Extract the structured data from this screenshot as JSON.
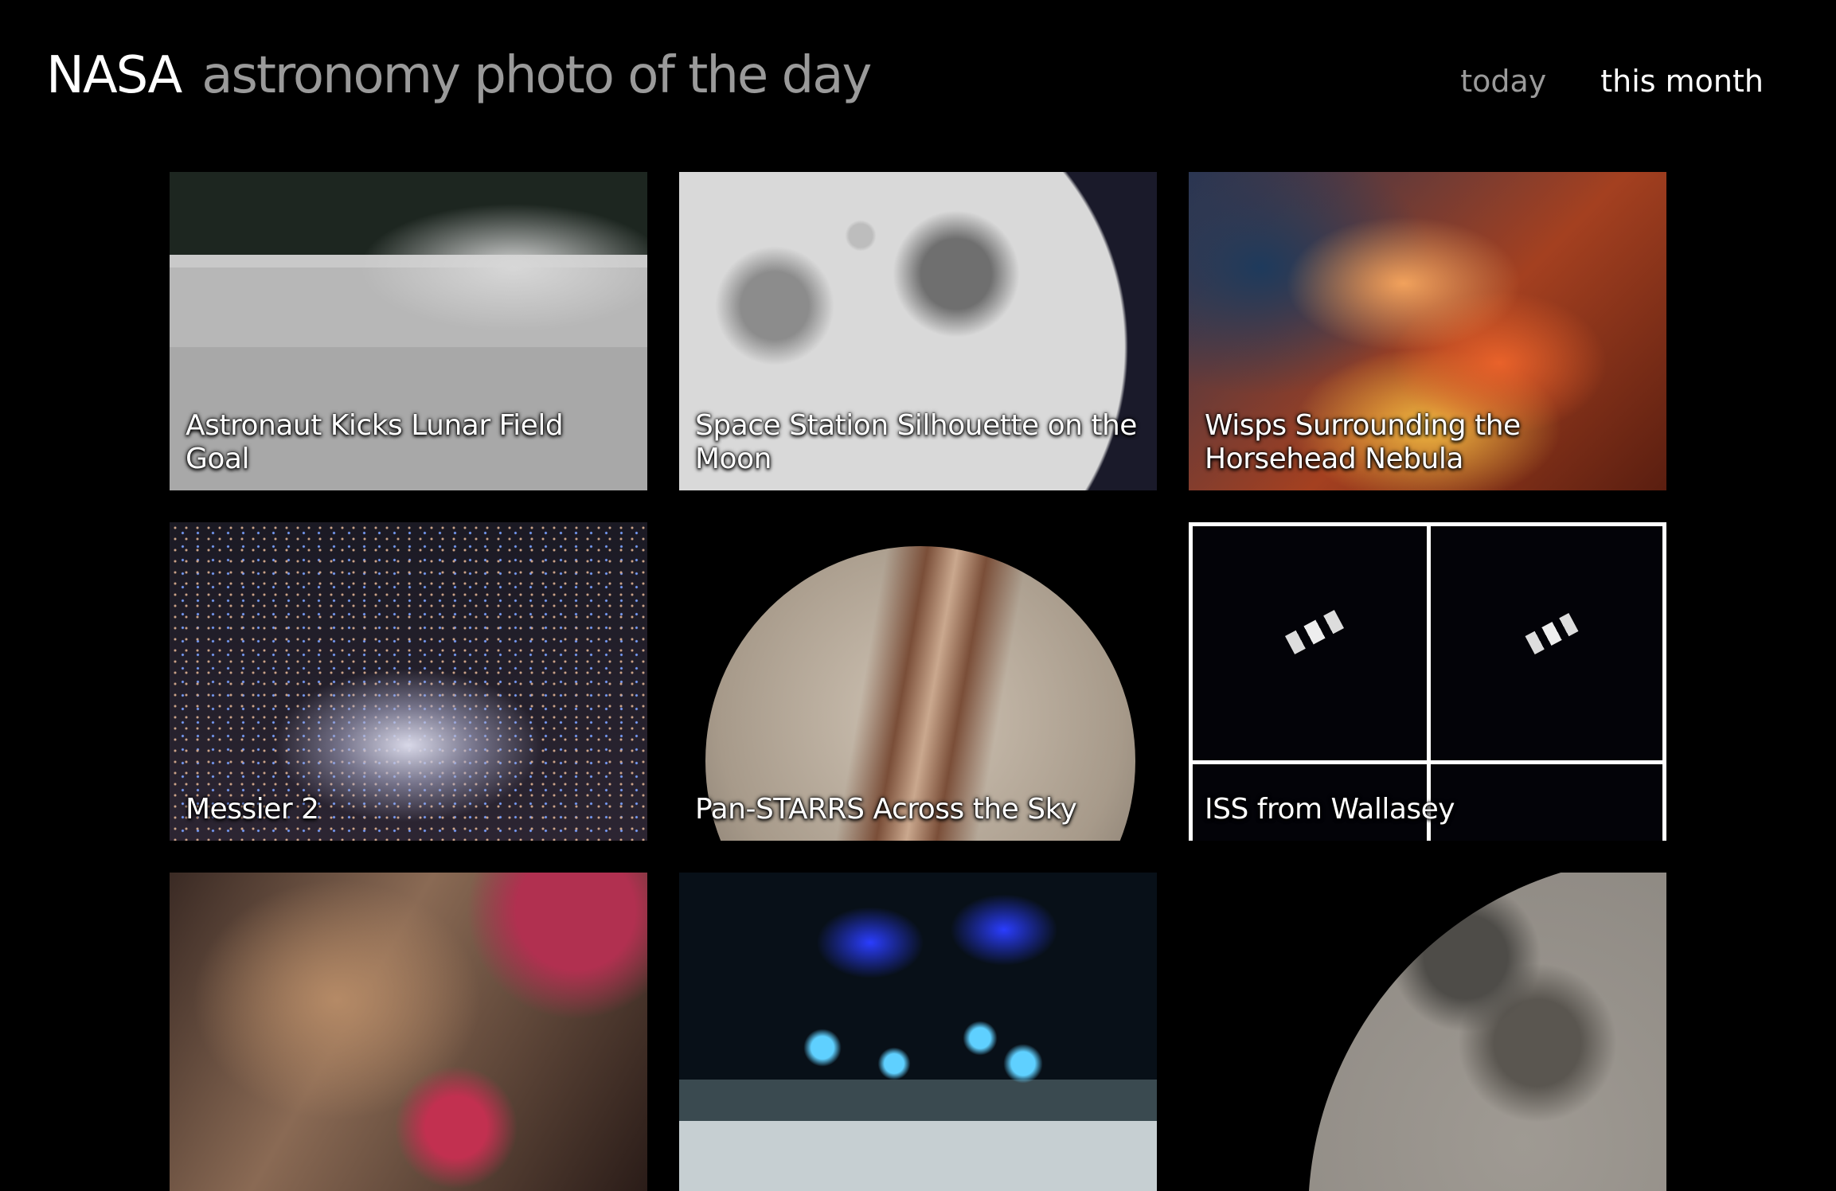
{
  "header": {
    "brand": "NASA",
    "subtitle": "astronomy photo of the day",
    "nav": {
      "today": "today",
      "this_month": "this month",
      "active": "this month"
    }
  },
  "colors": {
    "background": "#000000",
    "brand_text": "#ffffff",
    "muted_text": "#9a9a9a"
  },
  "photos": [
    {
      "title": "Astronaut Kicks Lunar Field Goal"
    },
    {
      "title": "Space Station Silhouette on the Moon"
    },
    {
      "title": "Wisps Surrounding the Horsehead Nebula"
    },
    {
      "title": "Messier 2"
    },
    {
      "title": "Pan-STARRS Across the Sky"
    },
    {
      "title": "ISS from Wallasey"
    },
    {
      "title": ""
    },
    {
      "title": ""
    },
    {
      "title": ""
    }
  ]
}
